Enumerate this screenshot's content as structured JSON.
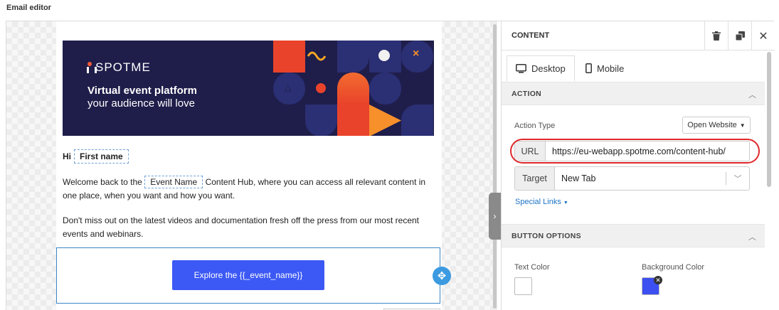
{
  "page": {
    "title": "Email editor"
  },
  "colors": {
    "accent": "#3c59f5",
    "link": "#1a73c7",
    "highlight": "#e0282a",
    "banner_bg": "#1f1d4a",
    "bg_swatch": "#3c4ff0",
    "text_swatch": "#ffffff"
  },
  "email": {
    "banner": {
      "brand": "SPOTME",
      "headline": "Virtual event platform",
      "subline": "your audience will love"
    },
    "greeting": {
      "prefix": "Hi",
      "tag": "First name"
    },
    "para1": {
      "before": "Welcome back to the",
      "tag": "Event Name",
      "after": "Content Hub, where you can access all relevant content in one place, when you want and how you want."
    },
    "para2": "Don't miss out on the latest videos and documentation fresh off the press from our most recent events and webinars.",
    "cta_label": "Explore the {{_event_name}}"
  },
  "panel": {
    "title": "CONTENT",
    "icons": {
      "delete": "trash-icon",
      "duplicate": "copy-icon",
      "close": "close-icon"
    },
    "tabs": [
      {
        "label": "Desktop",
        "icon": "monitor-icon",
        "active": true
      },
      {
        "label": "Mobile",
        "icon": "mobile-icon",
        "active": false
      }
    ],
    "action": {
      "section_label": "ACTION",
      "action_type_label": "Action Type",
      "action_type_value": "Open Website",
      "url_label": "URL",
      "url_value": "https://eu-webapp.spotme.com/content-hub/",
      "target_label": "Target",
      "target_value": "New Tab",
      "special_links": "Special Links"
    },
    "button_options": {
      "section_label": "BUTTON OPTIONS",
      "text_color_label": "Text Color",
      "background_color_label": "Background Color"
    }
  }
}
